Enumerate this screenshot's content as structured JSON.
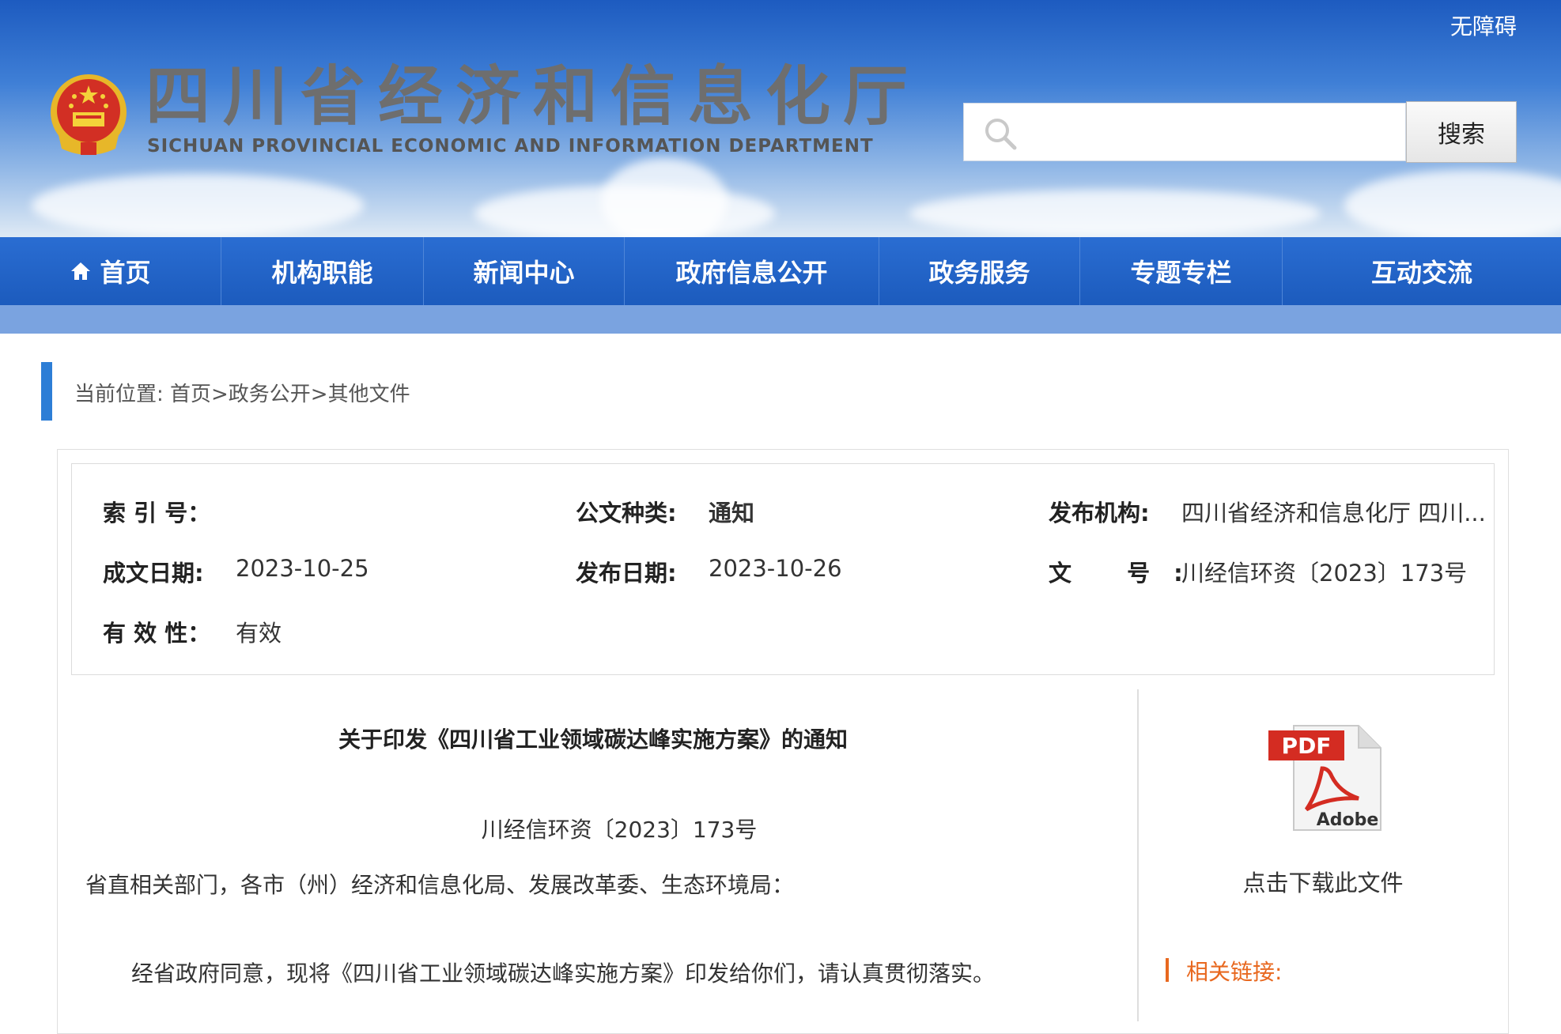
{
  "header": {
    "accessible_label": "无障碍",
    "site_title": "四川省经济和信息化厅",
    "site_subtitle": "SICHUAN PROVINCIAL ECONOMIC AND INFORMATION DEPARTMENT",
    "search_placeholder": "",
    "search_button": "搜索"
  },
  "nav": {
    "items": [
      "首页",
      "机构职能",
      "新闻中心",
      "政府信息公开",
      "政务服务",
      "专题专栏",
      "互动交流"
    ]
  },
  "breadcrumb": "当前位置: 首页>政务公开>其他文件",
  "meta": {
    "index_label": "索 引 号：",
    "index_value": "",
    "category_label": "公文种类:",
    "category_value": "通知",
    "publisher_label": "发布机构:",
    "publisher_value": "四川省经济和信息化厅 四川...",
    "written_label": "成文日期:",
    "written_value": "2023-10-25",
    "published_label": "发布日期:",
    "published_value": "2023-10-26",
    "docno_label": "文 号:",
    "docno_value": "川经信环资〔2023〕173号",
    "validity_label": "有 效 性：",
    "validity_value": "有效"
  },
  "article": {
    "title": "关于印发《四川省工业领域碳达峰实施方案》的通知",
    "doc_number": "川经信环资〔2023〕173号",
    "greeting": "省直相关部门，各市（州）经济和信息化局、发展改革委、生态环境局：",
    "paragraph": "经省政府同意，现将《四川省工业领域碳达峰实施方案》印发给你们，请认真贯彻落实。"
  },
  "side": {
    "download_label": "点击下载此文件",
    "pdf_badge": "PDF",
    "pdf_brand": "Adobe",
    "related_title": "相关链接:"
  },
  "colors": {
    "nav_blue": "#1c5bbd",
    "breadcrumb_accent": "#2d7ed6",
    "related_orange": "#e8681f"
  }
}
